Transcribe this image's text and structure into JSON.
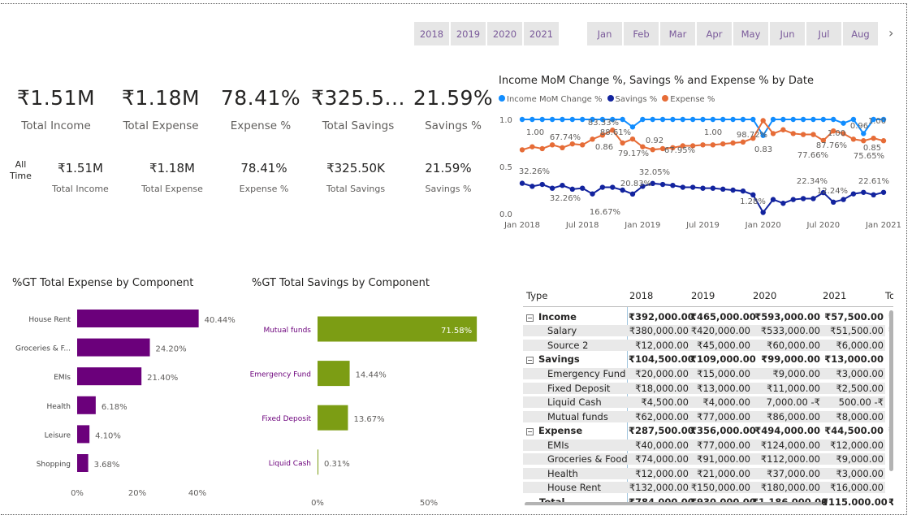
{
  "years": [
    "2018",
    "2019",
    "2020",
    "2021"
  ],
  "months": [
    "Jan",
    "Feb",
    "Mar",
    "Apr",
    "May",
    "Jun",
    "Jul",
    "Aug"
  ],
  "kpis_big": [
    {
      "value": "₹1.51M",
      "label": "Total Income"
    },
    {
      "value": "₹1.18M",
      "label": "Total Expense"
    },
    {
      "value": "78.41%",
      "label": "Expense %"
    },
    {
      "value": "₹325.5...",
      "label": "Total Savings"
    },
    {
      "value": "21.59%",
      "label": "Savings %"
    }
  ],
  "all_time": {
    "line1": "All",
    "line2": "Time"
  },
  "kpis_small": [
    {
      "value": "₹1.51M",
      "label": "Total Income"
    },
    {
      "value": "₹1.18M",
      "label": "Total Expense"
    },
    {
      "value": "78.41%",
      "label": "Expense %"
    },
    {
      "value": "₹325.50K",
      "label": "Total Savings"
    },
    {
      "value": "21.59%",
      "label": "Savings %"
    }
  ],
  "colors": {
    "income": "#118dff",
    "savings": "#12239e",
    "expense": "#e66c37",
    "expense_bar": "#6b007b",
    "savings_bar": "#7c9d14"
  },
  "line_chart": {
    "title": "Income MoM Change %, Savings % and Expense % by Date",
    "legend": [
      "Income MoM Change %",
      "Savings %",
      "Expense %"
    ],
    "x_ticks": [
      "Jan 2018",
      "Jul 2018",
      "Jan 2019",
      "Jul 2019",
      "Jan 2020",
      "Jul 2020",
      "Jan 2021"
    ],
    "y_ticks": [
      "1.0",
      "0.5",
      "0.0"
    ],
    "labels": [
      "1.00",
      "67.74%",
      "83.33%",
      "88.61%",
      "0.86",
      "79.17%",
      "0.92",
      "67.95%",
      "1.00",
      "98.72%",
      "0.83",
      "77.66%",
      "1.00",
      "87.76%",
      "0.96",
      "0.85",
      "75.65%",
      "1.00",
      "32.26%",
      "32.26%",
      "16.67%",
      "20.83%",
      "32.05%",
      "1.28%",
      "22.34%",
      "12.24%",
      "22.61%"
    ]
  },
  "chart_data": [
    {
      "type": "line",
      "title": "Income MoM Change %, Savings % and Expense % by Date",
      "x": [
        "Jan 2018",
        "Feb 2018",
        "Mar 2018",
        "Apr 2018",
        "May 2018",
        "Jun 2018",
        "Jul 2018",
        "Aug 2018",
        "Sep 2018",
        "Oct 2018",
        "Nov 2018",
        "Dec 2018",
        "Jan 2019",
        "Feb 2019",
        "Mar 2019",
        "Apr 2019",
        "May 2019",
        "Jun 2019",
        "Jul 2019",
        "Aug 2019",
        "Sep 2019",
        "Oct 2019",
        "Nov 2019",
        "Dec 2019",
        "Jan 2020",
        "Feb 2020",
        "Mar 2020",
        "Apr 2020",
        "May 2020",
        "Jun 2020",
        "Jul 2020",
        "Aug 2020",
        "Sep 2020",
        "Oct 2020",
        "Nov 2020",
        "Dec 2020",
        "Jan 2021"
      ],
      "series": [
        {
          "name": "Income MoM Change %",
          "values": [
            1.0,
            1.0,
            1.0,
            1.0,
            1.0,
            1.0,
            1.0,
            1.0,
            1.0,
            1.0,
            1.0,
            0.92,
            1.0,
            1.0,
            1.0,
            1.0,
            1.0,
            1.0,
            1.0,
            1.0,
            1.0,
            1.0,
            1.0,
            1.0,
            0.83,
            1.0,
            1.0,
            1.0,
            1.0,
            1.0,
            1.0,
            1.0,
            0.96,
            1.0,
            0.85,
            1.0,
            1.0
          ]
        },
        {
          "name": "Savings %",
          "values": [
            0.3226,
            0.29,
            0.31,
            0.27,
            0.3,
            0.26,
            0.27,
            0.21,
            0.28,
            0.28,
            0.25,
            0.2083,
            0.29,
            0.3205,
            0.31,
            0.3,
            0.28,
            0.28,
            0.27,
            0.27,
            0.26,
            0.25,
            0.24,
            0.2,
            0.0128,
            0.15,
            0.11,
            0.15,
            0.16,
            0.16,
            0.2234,
            0.1224,
            0.15,
            0.21,
            0.2261,
            0.2,
            0.2261
          ]
        },
        {
          "name": "Expense %",
          "values": [
            0.6774,
            0.71,
            0.69,
            0.73,
            0.7,
            0.74,
            0.73,
            0.79,
            0.8333,
            0.8861,
            0.75,
            0.7917,
            0.71,
            0.6795,
            0.69,
            0.7,
            0.72,
            0.72,
            0.73,
            0.73,
            0.74,
            0.75,
            0.76,
            0.8,
            0.9872,
            0.85,
            0.89,
            0.85,
            0.84,
            0.84,
            0.7766,
            0.8776,
            0.85,
            0.79,
            0.7739,
            0.8,
            0.7739
          ]
        }
      ],
      "ylim": [
        0.0,
        1.0
      ]
    },
    {
      "type": "bar",
      "title": "%GT Total Expense by Component",
      "categories": [
        "House Rent",
        "Groceries & F...",
        "EMIs",
        "Health",
        "Leisure",
        "Shopping"
      ],
      "values": [
        40.44,
        24.2,
        21.4,
        6.18,
        4.1,
        3.68
      ],
      "labels": [
        "40.44%",
        "24.20%",
        "21.40%",
        "6.18%",
        "4.10%",
        "3.68%"
      ],
      "x_ticks": [
        "0%",
        "20%",
        "40%"
      ],
      "xlim": [
        0,
        40
      ]
    },
    {
      "type": "bar",
      "title": "%GT Total Savings by Component",
      "categories": [
        "Mutual funds",
        "Emergency Fund",
        "Fixed Deposit",
        "Liquid Cash"
      ],
      "values": [
        71.58,
        14.44,
        13.67,
        0.31
      ],
      "labels": [
        "71.58%",
        "14.44%",
        "13.67%",
        "0.31%"
      ],
      "x_ticks": [
        "0%",
        "50%"
      ],
      "xlim": [
        0,
        50
      ]
    }
  ],
  "matrix": {
    "headers": [
      "Type",
      "2018",
      "2019",
      "2020",
      "2021",
      "To"
    ],
    "rows": [
      {
        "label": "Income",
        "group": true,
        "cells": [
          "₹392,000.00",
          "₹465,000.00",
          "₹593,000.00",
          "₹57,500.00",
          "₹"
        ]
      },
      {
        "label": "Salary",
        "group": false,
        "cells": [
          "₹380,000.00",
          "₹420,000.00",
          "₹533,000.00",
          "₹51,500.00",
          "₹"
        ]
      },
      {
        "label": "Source 2",
        "group": false,
        "cells": [
          "₹12,000.00",
          "₹45,000.00",
          "₹60,000.00",
          "₹6,000.00",
          ""
        ]
      },
      {
        "label": "Savings",
        "group": true,
        "cells": [
          "₹104,500.00",
          "₹109,000.00",
          "₹99,000.00",
          "₹13,000.00",
          ""
        ]
      },
      {
        "label": "Emergency Fund",
        "group": false,
        "cells": [
          "₹20,000.00",
          "₹15,000.00",
          "₹9,000.00",
          "₹3,000.00",
          ""
        ]
      },
      {
        "label": "Fixed Deposit",
        "group": false,
        "cells": [
          "₹18,000.00",
          "₹13,000.00",
          "₹11,000.00",
          "₹2,500.00",
          ""
        ]
      },
      {
        "label": "Liquid Cash",
        "group": false,
        "cells": [
          "₹4,500.00",
          "₹4,000.00",
          "7,000.00 -₹",
          "500.00 -₹",
          ""
        ]
      },
      {
        "label": "Mutual funds",
        "group": false,
        "cells": [
          "₹62,000.00",
          "₹77,000.00",
          "₹86,000.00",
          "₹8,000.00",
          ""
        ]
      },
      {
        "label": "Expense",
        "group": true,
        "cells": [
          "₹287,500.00",
          "₹356,000.00",
          "₹494,000.00",
          "₹44,500.00",
          "₹"
        ]
      },
      {
        "label": "EMIs",
        "group": false,
        "cells": [
          "₹40,000.00",
          "₹77,000.00",
          "₹124,000.00",
          "₹12,000.00",
          ""
        ]
      },
      {
        "label": "Groceries & Food",
        "group": false,
        "cells": [
          "₹74,000.00",
          "₹91,000.00",
          "₹112,000.00",
          "₹9,000.00",
          ""
        ]
      },
      {
        "label": "Health",
        "group": false,
        "cells": [
          "₹12,000.00",
          "₹21,000.00",
          "₹37,000.00",
          "₹3,000.00",
          ""
        ]
      },
      {
        "label": "House Rent",
        "group": false,
        "cells": [
          "₹132,000.00",
          "₹150,000.00",
          "₹180,000.00",
          "₹16,000.00",
          ""
        ]
      },
      {
        "label": "Total",
        "group": "total",
        "cells": [
          "₹784,000.00",
          "₹930,000.00",
          "₹1,186,000.00",
          "₹115,000.00",
          "₹"
        ]
      }
    ]
  }
}
